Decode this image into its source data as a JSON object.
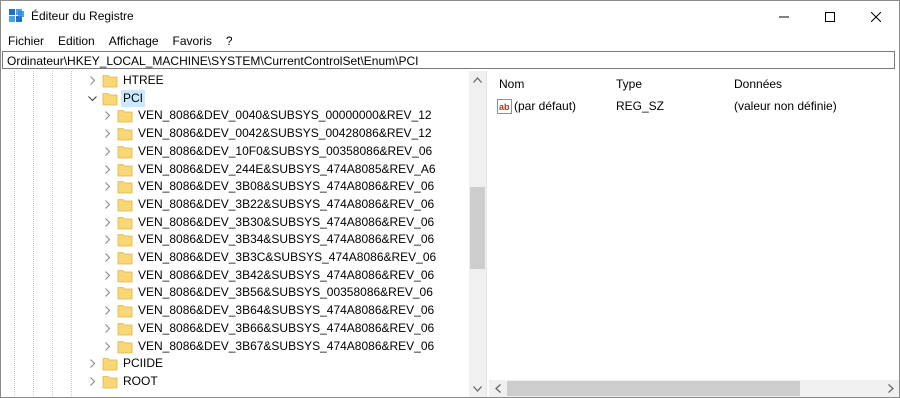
{
  "window": {
    "title": "Éditeur du Registre"
  },
  "menu": {
    "items": [
      "Fichier",
      "Edition",
      "Affichage",
      "Favoris",
      "?"
    ]
  },
  "address": {
    "path": "Ordinateur\\HKEY_LOCAL_MACHINE\\SYSTEM\\CurrentControlSet\\Enum\\PCI"
  },
  "tree": {
    "items": [
      {
        "label": "HTREE",
        "level": 1,
        "expanded": false
      },
      {
        "label": "PCI",
        "level": 1,
        "expanded": true,
        "selected": true
      },
      {
        "label": "VEN_8086&DEV_0040&SUBSYS_00000000&REV_12",
        "level": 2
      },
      {
        "label": "VEN_8086&DEV_0042&SUBSYS_00428086&REV_12",
        "level": 2
      },
      {
        "label": "VEN_8086&DEV_10F0&SUBSYS_00358086&REV_06",
        "level": 2
      },
      {
        "label": "VEN_8086&DEV_244E&SUBSYS_474A8085&REV_A6",
        "level": 2
      },
      {
        "label": "VEN_8086&DEV_3B08&SUBSYS_474A8086&REV_06",
        "level": 2
      },
      {
        "label": "VEN_8086&DEV_3B22&SUBSYS_474A8086&REV_06",
        "level": 2
      },
      {
        "label": "VEN_8086&DEV_3B30&SUBSYS_474A8086&REV_06",
        "level": 2
      },
      {
        "label": "VEN_8086&DEV_3B34&SUBSYS_474A8086&REV_06",
        "level": 2
      },
      {
        "label": "VEN_8086&DEV_3B3C&SUBSYS_474A8086&REV_06",
        "level": 2
      },
      {
        "label": "VEN_8086&DEV_3B42&SUBSYS_474A8086&REV_06",
        "level": 2
      },
      {
        "label": "VEN_8086&DEV_3B56&SUBSYS_00358086&REV_06",
        "level": 2
      },
      {
        "label": "VEN_8086&DEV_3B64&SUBSYS_474A8086&REV_06",
        "level": 2
      },
      {
        "label": "VEN_8086&DEV_3B66&SUBSYS_474A8086&REV_06",
        "level": 2
      },
      {
        "label": "VEN_8086&DEV_3B67&SUBSYS_474A8086&REV_06",
        "level": 2
      },
      {
        "label": "PCIIDE",
        "level": 1,
        "expanded": false
      },
      {
        "label": "ROOT",
        "level": 1,
        "expanded": false
      }
    ]
  },
  "values": {
    "columns": {
      "name": "Nom",
      "type": "Type",
      "data": "Données"
    },
    "rows": [
      {
        "name": "(par défaut)",
        "type": "REG_SZ",
        "data": "(valeur non définie)"
      }
    ]
  },
  "colors": {
    "folder": "#f8d775",
    "folder_dark": "#e0b547",
    "selection": "#cce8ff",
    "scrollbar": "#f0f0f0",
    "thumb": "#cdcdcd",
    "regedit_blue": "#1e70c9",
    "string_value_red": "#c42b1c"
  }
}
